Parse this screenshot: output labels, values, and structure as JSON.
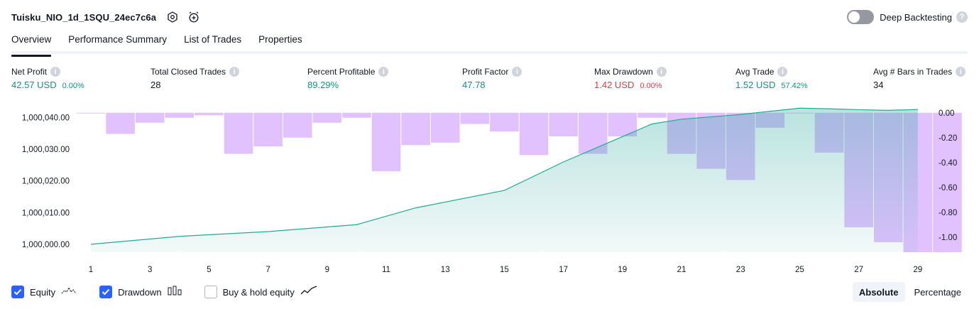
{
  "header": {
    "title": "Tuisku_NIO_1d_1SQU_24ec7c6a"
  },
  "deep_backtesting": {
    "label": "Deep Backtesting",
    "enabled": false
  },
  "tabs": [
    {
      "label": "Overview",
      "active": true
    },
    {
      "label": "Performance Summary",
      "active": false
    },
    {
      "label": "List of Trades",
      "active": false
    },
    {
      "label": "Properties",
      "active": false
    }
  ],
  "stats": {
    "net_profit": {
      "label": "Net Profit",
      "value": "42.57 USD",
      "sub": "0.00%"
    },
    "total_closed_trades": {
      "label": "Total Closed Trades",
      "value": "28"
    },
    "percent_profitable": {
      "label": "Percent Profitable",
      "value": "89.29%"
    },
    "profit_factor": {
      "label": "Profit Factor",
      "value": "47.78"
    },
    "max_drawdown": {
      "label": "Max Drawdown",
      "value": "1.42 USD",
      "sub": "0.00%"
    },
    "avg_trade": {
      "label": "Avg Trade",
      "value": "1.52 USD",
      "sub": "57.42%"
    },
    "avg_bars": {
      "label": "Avg # Bars in Trades",
      "value": "34"
    }
  },
  "legend": {
    "equity": {
      "label": "Equity",
      "checked": true
    },
    "drawdown": {
      "label": "Drawdown",
      "checked": true
    },
    "buy_hold": {
      "label": "Buy & hold equity",
      "checked": false
    }
  },
  "scale_buttons": {
    "absolute": "Absolute",
    "percentage": "Percentage",
    "selected": "Absolute"
  },
  "colors": {
    "equity_line": "#22ab94",
    "equity_fill": "#26a69a",
    "drawdown_bar": "#e1c2ff",
    "checkbox_on": "#2962ff",
    "positive": "#089981",
    "negative": "#f23645"
  },
  "chart_data": {
    "type": "area",
    "left_axis": {
      "ylim": [
        999997.5,
        1000043.5
      ],
      "ticks": [
        1000000,
        1000010,
        1000020,
        1000030,
        1000040
      ],
      "tick_labels": [
        "1,000,000.00",
        "1,000,010.00",
        "1,000,020.00",
        "1,000,030.00",
        "1,000,040.00"
      ]
    },
    "right_axis": {
      "ylim": [
        -1.12,
        0.05
      ],
      "ticks": [
        0,
        -0.2,
        -0.4,
        -0.6,
        -0.8,
        -1.0
      ],
      "tick_labels": [
        "0.00",
        "-0.20",
        "-0.40",
        "-0.60",
        "-0.80",
        "-1.00"
      ]
    },
    "x_ticks": [
      1,
      3,
      5,
      7,
      9,
      11,
      13,
      15,
      17,
      19,
      21,
      23,
      25,
      27,
      29
    ],
    "series": [
      {
        "name": "Equity",
        "x": [
          1,
          4,
          7,
          10,
          12,
          15,
          17,
          20,
          21,
          23,
          25,
          26,
          27,
          28,
          29
        ],
        "y": [
          1000000,
          1000002.5,
          1000004,
          1000006.2,
          1000011.5,
          1000017,
          1000026,
          1000038,
          1000039.5,
          1000041,
          1000043,
          1000042.8,
          1000042.5,
          1000042.3,
          1000042.57
        ]
      },
      {
        "name": "Drawdown",
        "x": [
          1,
          2,
          3,
          4,
          5,
          6,
          7,
          8,
          9,
          10,
          11,
          12,
          13,
          14,
          15,
          16,
          17,
          18,
          19,
          20,
          21,
          22,
          23,
          24,
          25,
          26,
          27,
          28,
          29,
          30
        ],
        "y": [
          0,
          -0.17,
          -0.08,
          -0.04,
          -0.02,
          -0.33,
          -0.27,
          -0.2,
          -0.08,
          -0.04,
          -0.47,
          -0.26,
          -0.24,
          -0.09,
          -0.15,
          -0.34,
          -0.19,
          -0.33,
          -0.19,
          -0.04,
          -0.33,
          -0.45,
          -0.54,
          -0.12,
          0,
          -0.32,
          -0.92,
          -1.04,
          -1.12,
          -1.12
        ]
      }
    ]
  }
}
